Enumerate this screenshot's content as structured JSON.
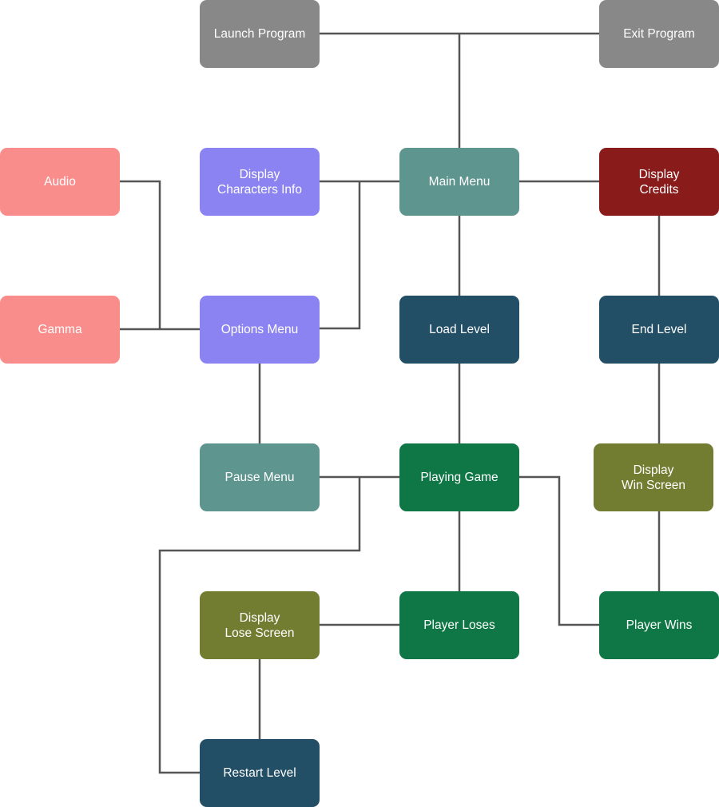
{
  "colors": {
    "gray": "#888888",
    "salmon": "#f98d8b",
    "purple": "#8c83f2",
    "teal": "#5f958f",
    "darkred": "#8a1b1b",
    "navy": "#224e66",
    "green": "#0f7645",
    "olive": "#737d31",
    "line": "#555555"
  },
  "nodes": [
    {
      "id": "launch",
      "label": "Launch Program",
      "color": "gray"
    },
    {
      "id": "exit",
      "label": "Exit Program",
      "color": "gray"
    },
    {
      "id": "audio",
      "label": "Audio",
      "color": "salmon"
    },
    {
      "id": "chars",
      "label": "Display\nCharacters Info",
      "color": "purple"
    },
    {
      "id": "main",
      "label": "Main Menu",
      "color": "teal"
    },
    {
      "id": "credits",
      "label": "Display\nCredits",
      "color": "darkred"
    },
    {
      "id": "gamma",
      "label": "Gamma",
      "color": "salmon"
    },
    {
      "id": "options",
      "label": "Options Menu",
      "color": "purple"
    },
    {
      "id": "load",
      "label": "Load Level",
      "color": "navy"
    },
    {
      "id": "endlevel",
      "label": "End Level",
      "color": "navy"
    },
    {
      "id": "pause",
      "label": "Pause Menu",
      "color": "teal"
    },
    {
      "id": "playing",
      "label": "Playing Game",
      "color": "green"
    },
    {
      "id": "winscreen",
      "label": "Display\nWin Screen",
      "color": "olive"
    },
    {
      "id": "losescreen",
      "label": "Display\nLose Screen",
      "color": "olive"
    },
    {
      "id": "loses",
      "label": "Player Loses",
      "color": "green"
    },
    {
      "id": "wins",
      "label": "Player Wins",
      "color": "green"
    },
    {
      "id": "restart",
      "label": "Restart Level",
      "color": "navy"
    }
  ],
  "edges": [
    {
      "from": "launch",
      "to": "exit"
    },
    {
      "from": "launch",
      "to": "main"
    },
    {
      "from": "audio",
      "to": "options"
    },
    {
      "from": "gamma",
      "to": "options"
    },
    {
      "from": "chars",
      "to": "main"
    },
    {
      "from": "options",
      "to": "main"
    },
    {
      "from": "main",
      "to": "credits"
    },
    {
      "from": "main",
      "to": "load"
    },
    {
      "from": "load",
      "to": "playing"
    },
    {
      "from": "credits",
      "to": "endlevel"
    },
    {
      "from": "endlevel",
      "to": "winscreen"
    },
    {
      "from": "winscreen",
      "to": "wins"
    },
    {
      "from": "options",
      "to": "pause"
    },
    {
      "from": "pause",
      "to": "playing"
    },
    {
      "from": "playing",
      "to": "restart"
    },
    {
      "from": "playing",
      "to": "wins"
    },
    {
      "from": "playing",
      "to": "loses"
    },
    {
      "from": "losescreen",
      "to": "loses"
    },
    {
      "from": "losescreen",
      "to": "restart"
    }
  ]
}
